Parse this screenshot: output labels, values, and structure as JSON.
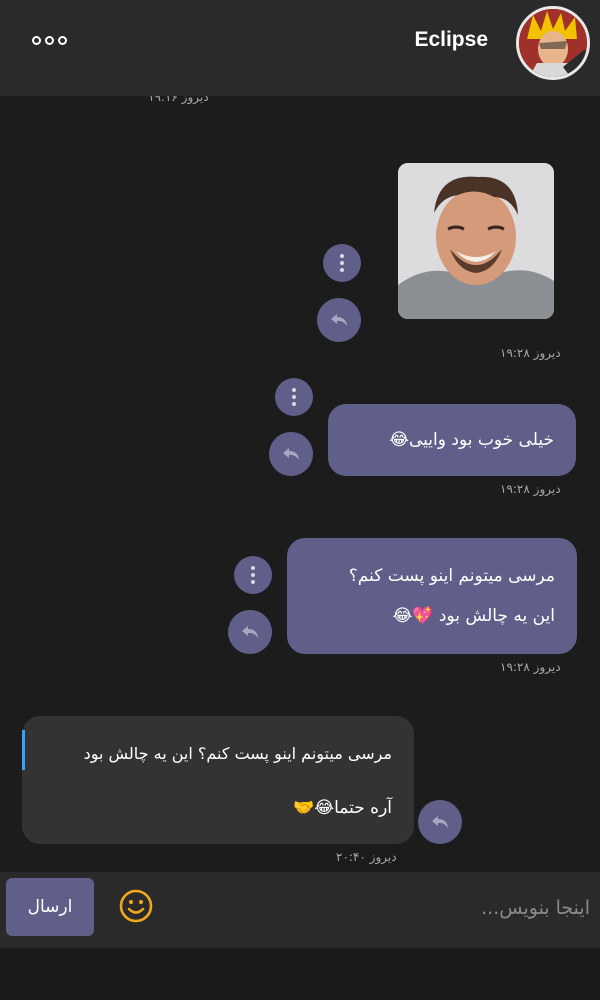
{
  "header": {
    "contact_name": "Eclipse",
    "menu_icon": "more-horizontal-icon"
  },
  "messages": [
    {
      "id": "m0",
      "timestamp": "دیروز ۱۹:۱۶"
    },
    {
      "id": "m1",
      "type": "image",
      "image_desc": "photo-of-laughing-man",
      "timestamp": "دیروز ۱۹:۲۸"
    },
    {
      "id": "m2",
      "text": "خیلی خوب بود واییی😂",
      "timestamp": "دیروز ۱۹:۲۸"
    },
    {
      "id": "m3",
      "line1": "مرسی میتونم اینو پست کنم؟",
      "line2": "این یه چالش بود 💖😂",
      "timestamp": "دیروز ۱۹:۲۸"
    },
    {
      "id": "m4",
      "quote": "مرسی میتونم اینو پست کنم؟ این یه چالش بود",
      "text": "آره حتما😂🤝",
      "timestamp": "دیروز ۲۰:۴۰"
    }
  ],
  "composer": {
    "placeholder": "اینجا بنویس...",
    "value": "",
    "send_label": "ارسال"
  },
  "colors": {
    "accent": "#5f5f89",
    "incoming_bubble": "#333334",
    "header_bg": "#2a2a2b",
    "chat_bg": "#1c1c1d",
    "quote_bar": "#3aa0ff",
    "emoji_icon": "#f2a81d"
  }
}
